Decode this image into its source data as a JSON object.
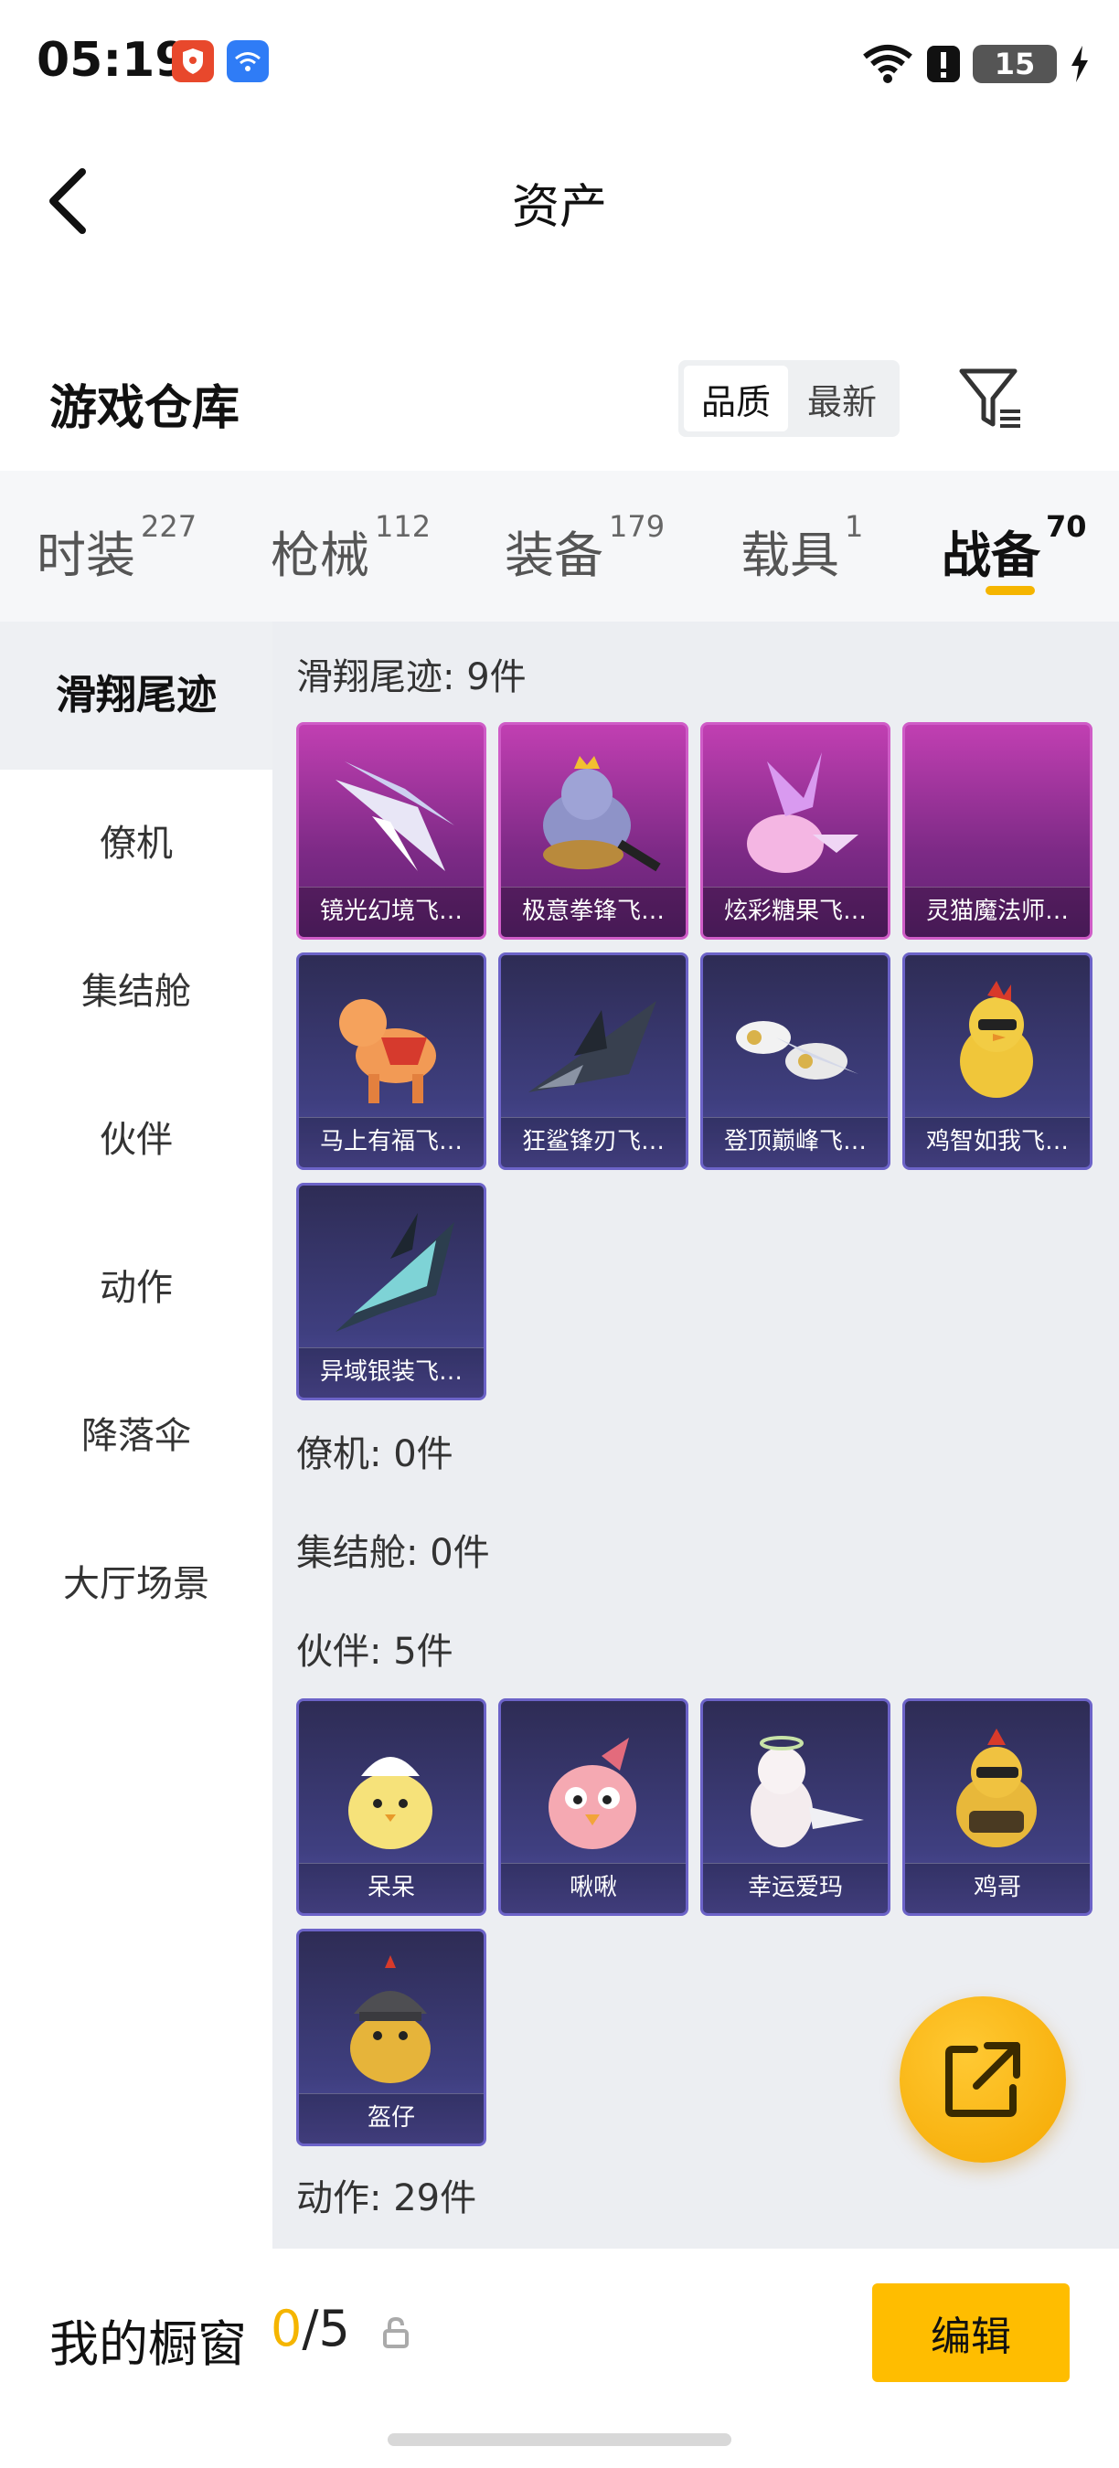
{
  "status_bar": {
    "time": "05:19",
    "battery": "15"
  },
  "header": {
    "title": "资产"
  },
  "warehouse": {
    "title": "游戏仓库",
    "sort_options": [
      "品质",
      "最新"
    ],
    "selected_sort": "品质"
  },
  "tabs": [
    {
      "label": "时装",
      "count": "227"
    },
    {
      "label": "枪械",
      "count": "112"
    },
    {
      "label": "装备",
      "count": "179"
    },
    {
      "label": "载具",
      "count": "1"
    },
    {
      "label": "战备",
      "count": "70"
    }
  ],
  "active_tab": "战备",
  "sidebar": {
    "items": [
      "滑翔尾迹",
      "僚机",
      "集结舱",
      "伙伴",
      "动作",
      "降落伞",
      "大厅场景"
    ],
    "active": "滑翔尾迹"
  },
  "sections": {
    "glide_trail": {
      "title": "滑翔尾迹: 9件",
      "items": [
        "镜光幻境飞…",
        "极意拳锋飞…",
        "炫彩糖果飞…",
        "灵猫魔法师…",
        "马上有福飞…",
        "狂鲨锋刃飞…",
        "登顶巅峰飞…",
        "鸡智如我飞…",
        "异域银装飞…"
      ]
    },
    "wingman": {
      "title": "僚机: 0件"
    },
    "rally_pod": {
      "title": "集结舱: 0件"
    },
    "partner": {
      "title": "伙伴: 5件",
      "items": [
        "呆呆",
        "啾啾",
        "幸运爱玛",
        "鸡哥",
        "盔仔"
      ]
    },
    "emote": {
      "title": "动作: 29件"
    }
  },
  "bottom": {
    "title": "我的橱窗",
    "count_current": "0",
    "count_total": "/5",
    "edit_label": "编辑"
  },
  "colors": {
    "accent": "#f5b500",
    "epic_purple": "#a93a9f",
    "rare_blue": "#3f3f80"
  }
}
